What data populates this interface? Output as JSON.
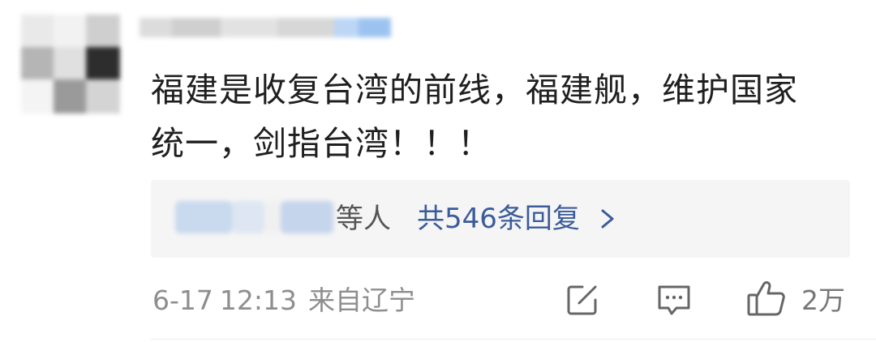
{
  "comment": {
    "user": {
      "avatar": "blurred-avatar",
      "name_blurred": true
    },
    "text_line1": "福建是收复台湾的前线，福建舰，维护国家",
    "text_line2": "统一，剑指台湾！！！",
    "replies": {
      "names_blurred": true,
      "suffix": "等人",
      "link_label": "共546条回复",
      "link_color": "#3b5b9a",
      "chevron_icon": "chevron-right-icon"
    },
    "meta": {
      "date": "6-17",
      "time": "12:13",
      "location": "来自辽宁"
    },
    "actions": {
      "share_icon": "share-edit-icon",
      "comment_icon": "comment-icon",
      "like_icon": "thumbs-up-icon",
      "like_count": "2万"
    }
  }
}
